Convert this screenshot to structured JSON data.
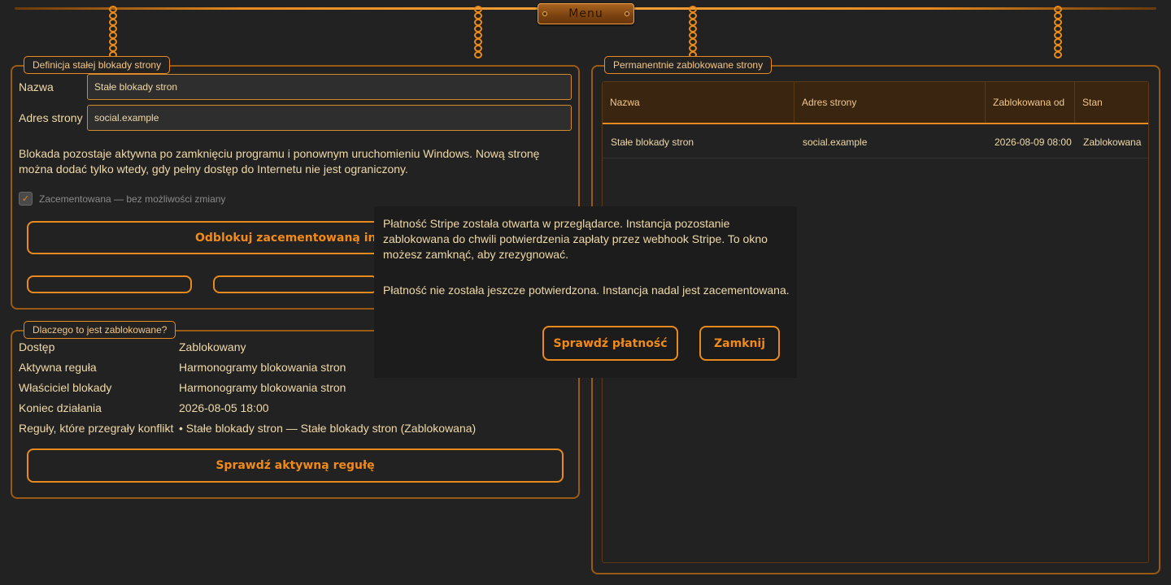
{
  "menu": {
    "label": "Menu"
  },
  "definition": {
    "title": "Definicja stałej blokady strony",
    "name_label": "Nazwa",
    "name_value": "Stałe blokady stron",
    "address_label": "Adres strony",
    "address_value": "social.example",
    "info": "Blokada pozostaje aktywna po zamknięciu programu i ponownym uruchomieniu Windows. Nową stronę można dodać tylko wtedy, gdy pełny dostęp do Internetu nie jest ograniczony.",
    "cemented_label": "Zacementowana — bez możliwości zmiany",
    "cemented_checked": true,
    "unlock_button": "Odblokuj zacementowaną instancję",
    "small_button_1": "",
    "small_button_2": ""
  },
  "why": {
    "title": "Dlaczego to jest zablokowane?",
    "rows": [
      {
        "key": "Dostęp",
        "value": "Zablokowany"
      },
      {
        "key": "Aktywna reguła",
        "value": "Harmonogramy blokowania stron"
      },
      {
        "key": "Właściciel blokady",
        "value": "Harmonogramy blokowania stron"
      },
      {
        "key": "Koniec działania",
        "value": "2026-08-05 18:00"
      },
      {
        "key": "Reguły, które przegrały konflikt",
        "value": "• Stałe blokady stron — Stałe blokady stron (Zablokowana)"
      }
    ],
    "check_button": "Sprawdź aktywną regułę"
  },
  "blocked": {
    "title": "Permanentnie zablokowane strony",
    "columns": [
      "Nazwa",
      "Adres strony",
      "Zablokowana od",
      "Stan"
    ],
    "rows": [
      [
        "Stałe blokady stron",
        "social.example",
        "2026-08-09 08:00",
        "Zablokowana"
      ]
    ]
  },
  "dialog": {
    "message": "Płatność Stripe została otwarta w przeglądarce. Instancja pozostanie zablokowana do chwili potwierdzenia zapłaty przez webhook Stripe. To okno możesz zamknąć, aby zrezygnować.",
    "status": "Płatność nie została jeszcze potwierdzona. Instancja nadal jest zacementowana.",
    "check_payment_button": "Sprawdź płatność",
    "close_button": "Zamknij"
  },
  "colors": {
    "accent": "#e88a1e",
    "background": "#222222",
    "text": "#f0d9a8"
  }
}
